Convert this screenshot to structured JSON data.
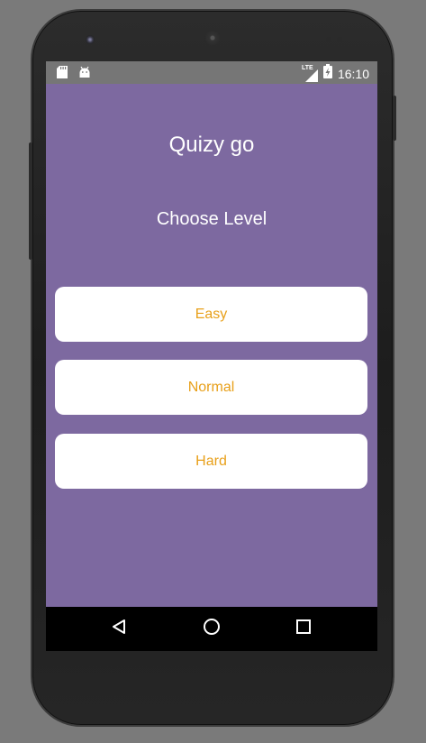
{
  "app": {
    "title": "Quizy go",
    "subtitle": "Choose Level"
  },
  "status_bar": {
    "time": "16:10",
    "network_label": "LTE",
    "left_icons": [
      "sd-card-icon",
      "android-icon"
    ],
    "right_icons": [
      "signal-icon",
      "battery-charging-icon"
    ]
  },
  "levels": [
    {
      "label": "Easy"
    },
    {
      "label": "Normal"
    },
    {
      "label": "Hard"
    }
  ],
  "nav_bar": {
    "buttons": [
      "back-icon",
      "home-icon",
      "recents-icon"
    ]
  },
  "colors": {
    "screen_background": "#7d69a0",
    "button_background": "#ffffff",
    "button_text": "#e8a01a",
    "status_bar": "#767676",
    "nav_bar": "#000000"
  }
}
